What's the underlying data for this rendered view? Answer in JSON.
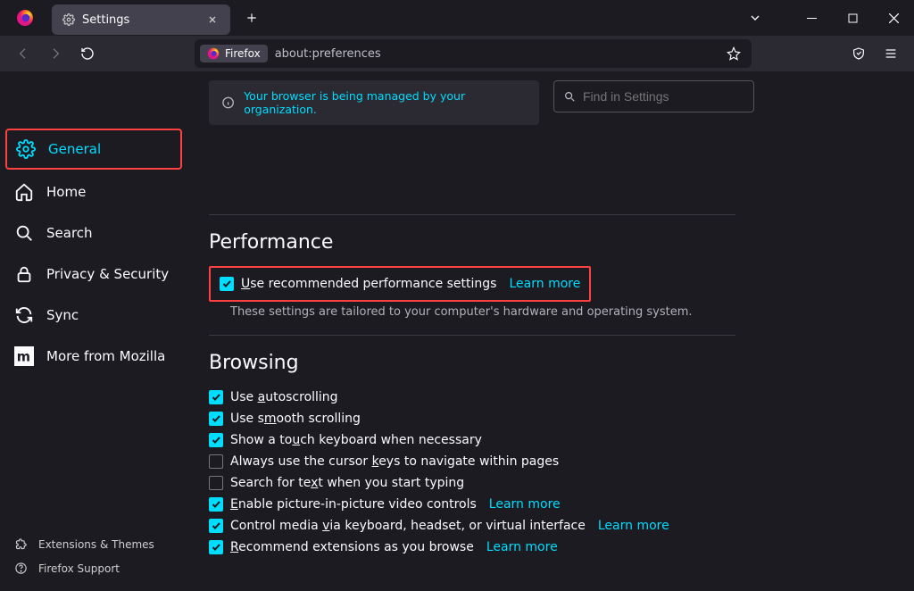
{
  "tab": {
    "title": "Settings"
  },
  "urlbar": {
    "identity": "Firefox",
    "url": "about:preferences"
  },
  "sidebar": {
    "categories": [
      {
        "label": "General"
      },
      {
        "label": "Home"
      },
      {
        "label": "Search"
      },
      {
        "label": "Privacy & Security"
      },
      {
        "label": "Sync"
      },
      {
        "label": "More from Mozilla"
      }
    ],
    "footer": [
      {
        "label": "Extensions & Themes"
      },
      {
        "label": "Firefox Support"
      }
    ]
  },
  "notice": "Your browser is being managed by your organization.",
  "search": {
    "placeholder": "Find in Settings"
  },
  "performance": {
    "title": "Performance",
    "rec_label": "Use recommended performance settings",
    "learn": "Learn more",
    "subnote": "These settings are tailored to your computer's hardware and operating system."
  },
  "browsing": {
    "title": "Browsing",
    "items": [
      {
        "label_pre": "Use ",
        "under": "a",
        "label_post": "utoscrolling",
        "checked": true,
        "learn": ""
      },
      {
        "label_pre": "Use s",
        "under": "m",
        "label_post": "ooth scrolling",
        "checked": true,
        "learn": ""
      },
      {
        "label_pre": "Show a to",
        "under": "u",
        "label_post": "ch keyboard when necessary",
        "checked": true,
        "learn": ""
      },
      {
        "label_pre": "Always use the cursor ",
        "under": "k",
        "label_post": "eys to navigate within pages",
        "checked": false,
        "learn": ""
      },
      {
        "label_pre": "Search for te",
        "under": "x",
        "label_post": "t when you start typing",
        "checked": false,
        "learn": ""
      },
      {
        "label_pre": "",
        "under": "E",
        "label_post": "nable picture-in-picture video controls",
        "checked": true,
        "learn": "Learn more"
      },
      {
        "label_pre": "Control media ",
        "under": "v",
        "label_post": "ia keyboard, headset, or virtual interface",
        "checked": true,
        "learn": "Learn more"
      },
      {
        "label_pre": "",
        "under": "R",
        "label_post": "ecommend extensions as you browse",
        "checked": true,
        "learn": "Learn more"
      }
    ]
  }
}
